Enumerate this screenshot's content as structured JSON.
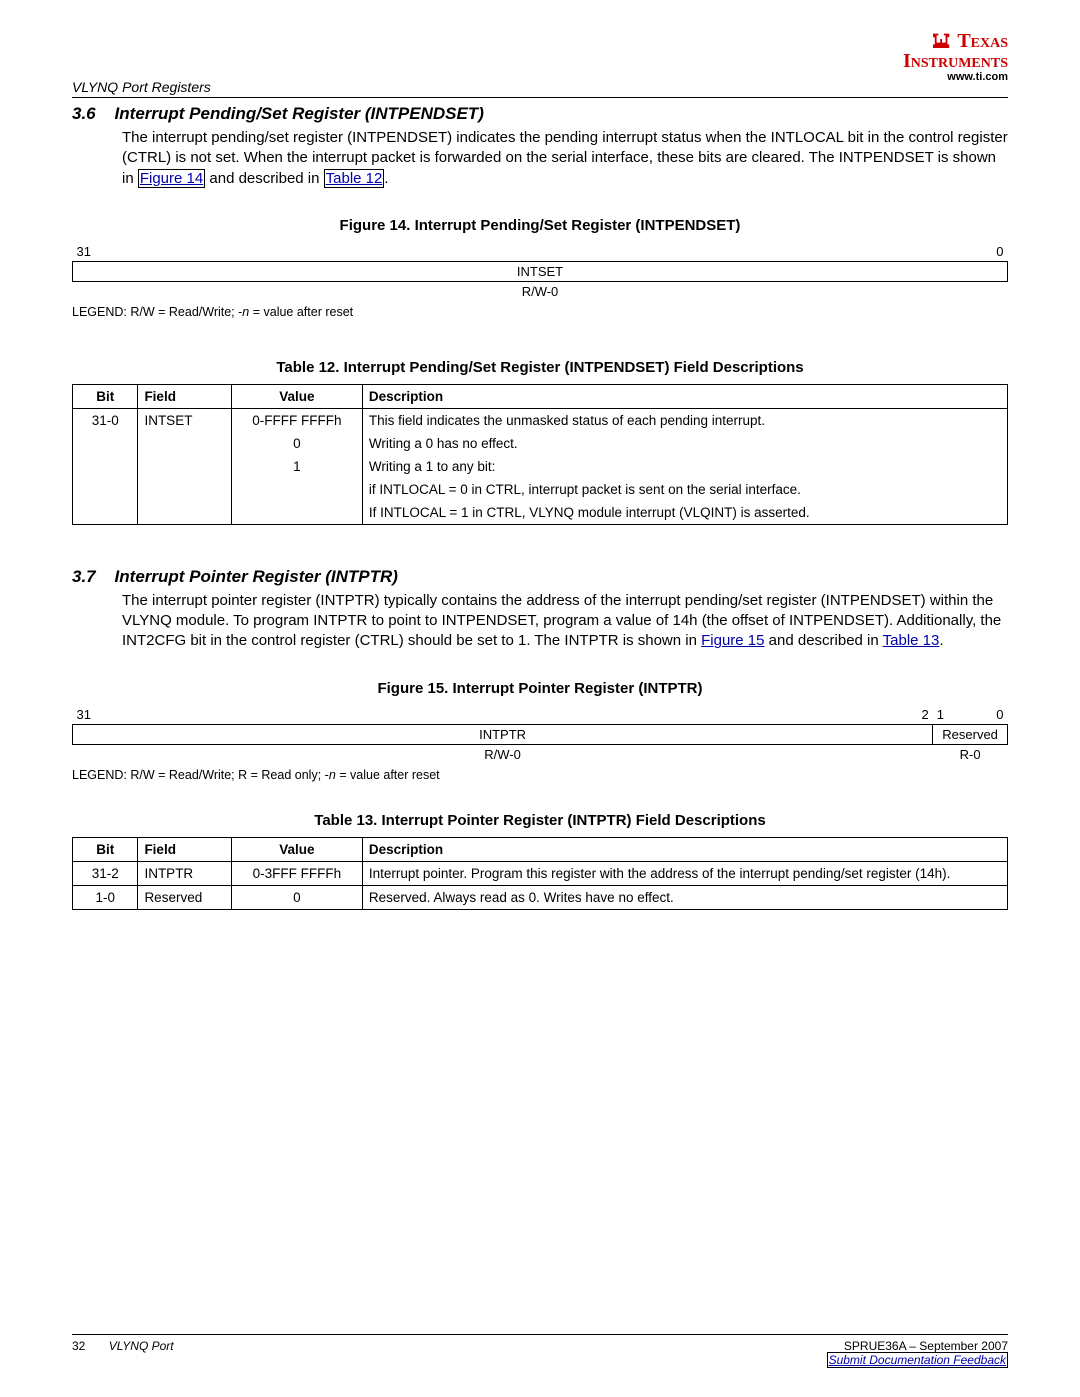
{
  "header": {
    "doc_section": "VLYNQ Port Registers",
    "logo_top": "Texas",
    "logo_bottom": "Instruments",
    "url": "www.ti.com"
  },
  "sec36": {
    "number": "3.6",
    "title": "Interrupt Pending/Set Register (INTPENDSET)",
    "para_pre": "The interrupt pending/set register (INTPENDSET) indicates the pending interrupt status when the INTLOCAL bit in the control register (CTRL) is not set. When the interrupt packet is forwarded on the serial interface, these bits are cleared. The INTPENDSET is shown in ",
    "fig_link": "Figure 14",
    "para_mid": " and described in ",
    "tbl_link": "Table 12",
    "para_end": "."
  },
  "fig14": {
    "caption": "Figure 14. Interrupt Pending/Set Register (INTPENDSET)",
    "bit_hi": "31",
    "bit_lo": "0",
    "field_name": "INTSET",
    "field_rw": "R/W-0",
    "legend_pre": "LEGEND: R/W = Read/Write; -",
    "legend_n": "n",
    "legend_post": " = value after reset"
  },
  "tbl12": {
    "caption": "Table 12. Interrupt Pending/Set Register (INTPENDSET) Field Descriptions",
    "headers": {
      "bit": "Bit",
      "field": "Field",
      "value": "Value",
      "desc": "Description"
    },
    "rows": [
      {
        "bit": "31-0",
        "field": "INTSET",
        "value": "0-FFFF FFFFh",
        "desc": "This field indicates the unmasked status of each pending interrupt."
      },
      {
        "bit": "",
        "field": "",
        "value": "0",
        "desc": "Writing a 0 has no effect."
      },
      {
        "bit": "",
        "field": "",
        "value": "1",
        "desc": "Writing a 1 to any bit:"
      },
      {
        "bit": "",
        "field": "",
        "value": "",
        "desc": "if INTLOCAL = 0 in CTRL, interrupt packet is sent on the serial interface."
      },
      {
        "bit": "",
        "field": "",
        "value": "",
        "desc": "If INTLOCAL = 1 in CTRL, VLYNQ module interrupt (VLQINT) is asserted."
      }
    ]
  },
  "sec37": {
    "number": "3.7",
    "title": "Interrupt Pointer Register (INTPTR)",
    "para_pre": "The interrupt pointer register (INTPTR) typically contains the address of the interrupt pending/set register (INTPENDSET) within the VLYNQ module. To program INTPTR to point to INTPENDSET, program a value of 14h (the offset of INTPENDSET). Additionally, the INT2CFG bit in the control register (CTRL) should be set to 1. The INTPTR is shown in ",
    "fig_link": "Figure 15",
    "para_mid": " and described in ",
    "tbl_link": "Table 13",
    "para_end": "."
  },
  "fig15": {
    "caption": "Figure 15. Interrupt Pointer Register (INTPTR)",
    "bit_hi": "31",
    "bit_mid_hi": "2",
    "bit_mid_lo": "1",
    "bit_lo": "0",
    "field1_name": "INTPTR",
    "field2_name": "Reserved",
    "field1_rw": "R/W-0",
    "field2_rw": "R-0",
    "legend_pre": "LEGEND: R/W = Read/Write; R = Read only; -",
    "legend_n": "n",
    "legend_post": " = value after reset"
  },
  "tbl13": {
    "caption": "Table 13. Interrupt Pointer Register (INTPTR) Field Descriptions",
    "headers": {
      "bit": "Bit",
      "field": "Field",
      "value": "Value",
      "desc": "Description"
    },
    "rows": [
      {
        "bit": "31-2",
        "field": "INTPTR",
        "value": "0-3FFF FFFFh",
        "desc": "Interrupt pointer. Program this register with the address of the interrupt pending/set register (14h)."
      },
      {
        "bit": "1-0",
        "field": "Reserved",
        "value": "0",
        "desc": "Reserved. Always read as 0. Writes have no effect."
      }
    ]
  },
  "footer": {
    "page_num": "32",
    "doc_title": "VLYNQ Port",
    "doc_id": "SPRUE36A – September 2007",
    "feedback": "Submit Documentation Feedback"
  }
}
